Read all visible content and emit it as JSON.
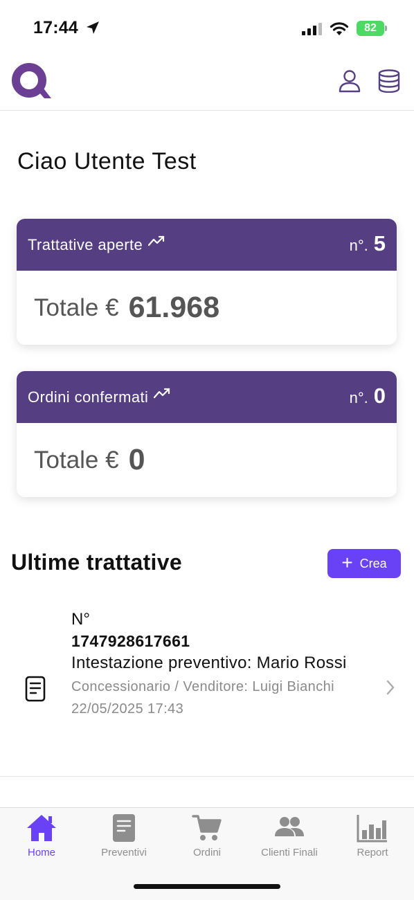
{
  "status_bar": {
    "time": "17:44",
    "battery": "82"
  },
  "header": {
    "logo": "Q"
  },
  "greeting": "Ciao Utente Test",
  "cards": [
    {
      "title": "Trattative aperte",
      "count_prefix": "n°.",
      "count": "5",
      "total_label": "Totale €",
      "total_value": "61.968"
    },
    {
      "title": "Ordini confermati",
      "count_prefix": "n°.",
      "count": "0",
      "total_label": "Totale €",
      "total_value": "0"
    }
  ],
  "latest": {
    "title": "Ultime trattative",
    "create_label": "Crea",
    "items": [
      {
        "number_label": "N°",
        "number": "1747928617661",
        "holder": "Intestazione preventivo: Mario Rossi",
        "seller": "Concessionario / Venditore: Luigi Bianchi",
        "date": "22/05/2025 17:43"
      }
    ]
  },
  "tabs": [
    {
      "label": "Home",
      "icon": "home-icon",
      "active": true
    },
    {
      "label": "Preventivi",
      "icon": "document-icon",
      "active": false
    },
    {
      "label": "Ordini",
      "icon": "cart-icon",
      "active": false
    },
    {
      "label": "Clienti Finali",
      "icon": "people-icon",
      "active": false
    },
    {
      "label": "Report",
      "icon": "bar-chart-icon",
      "active": false
    }
  ],
  "colors": {
    "primary": "#553f82",
    "accent": "#6a42f5",
    "logo": "#6b3f94"
  }
}
